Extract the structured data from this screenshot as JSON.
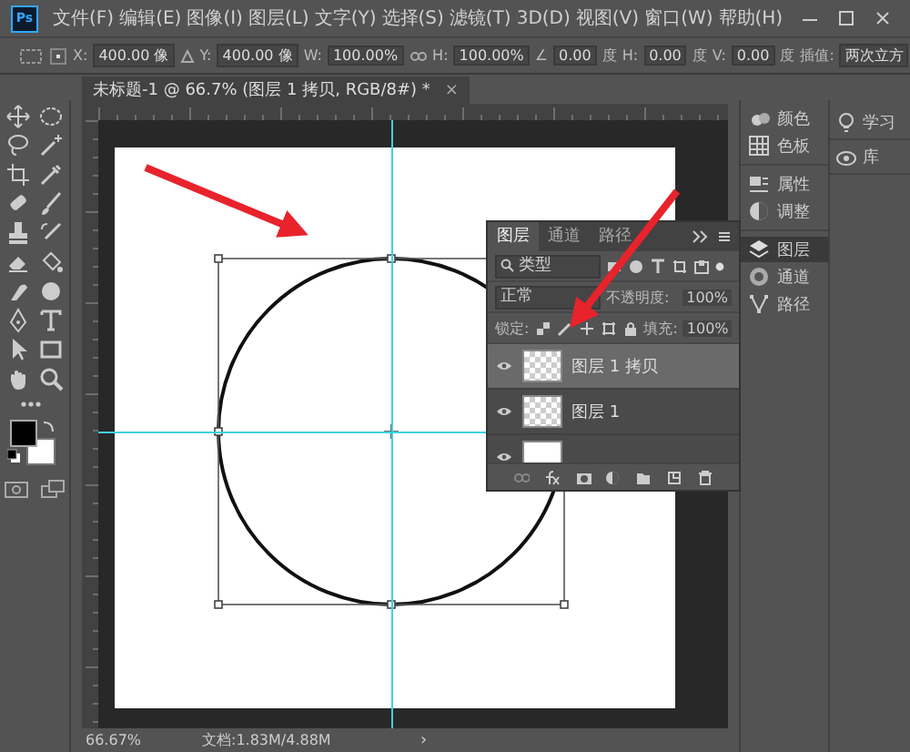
{
  "app": {
    "logo": "Ps"
  },
  "menu": [
    "文件(F)",
    "编辑(E)",
    "图像(I)",
    "图层(L)",
    "文字(Y)",
    "选择(S)",
    "滤镜(T)",
    "3D(D)",
    "视图(V)",
    "窗口(W)",
    "帮助(H)"
  ],
  "options": [
    {
      "label": "X:",
      "value": "400.00 像"
    },
    {
      "label": "Y:",
      "value": "400.00 像"
    },
    {
      "label": "W:",
      "value": "100.00%"
    },
    {
      "label": "H:",
      "value": "100.00%"
    },
    {
      "label": "∠",
      "value": "0.00",
      "unit": "度"
    },
    {
      "label": "H:",
      "value": "0.00",
      "unit": "度"
    },
    {
      "label": "V:",
      "value": "0.00",
      "unit": "度"
    },
    {
      "label": "插值:",
      "value": "两次立方"
    }
  ],
  "document_tab": {
    "title": "未标题-1 @ 66.7% (图层 1 拷贝, RGB/8#) *",
    "close": "×"
  },
  "layers_panel": {
    "tabs": [
      {
        "label": "图层",
        "selected": true
      },
      {
        "label": "通道",
        "selected": false
      },
      {
        "label": "路径",
        "selected": false
      }
    ],
    "filter": "类型",
    "blend_mode": "正常",
    "opacity_label": "不透明度:",
    "opacity": "100%",
    "lock_label": "锁定:",
    "fill_label": "填充:",
    "fill": "100%",
    "layers": [
      {
        "name": "图层 1 拷贝",
        "visible": true,
        "selected": true,
        "transparent": true
      },
      {
        "name": "图层 1",
        "visible": true,
        "selected": false,
        "transparent": true
      },
      {
        "visible": true,
        "selected": false,
        "transparent": false
      }
    ]
  },
  "dock": [
    {
      "label": "颜色",
      "selected": false
    },
    {
      "label": "色板",
      "selected": false
    },
    {
      "label": "属性",
      "selected": false
    },
    {
      "label": "调整",
      "selected": false
    },
    {
      "label": "图层",
      "selected": true
    },
    {
      "label": "通道",
      "selected": false
    },
    {
      "label": "路径",
      "selected": false
    }
  ],
  "dock2": [
    {
      "label": "学习"
    },
    {
      "label": "库"
    }
  ],
  "status_bar": {
    "zoom": "66.67%",
    "doc": "文档:1.83M/4.88M",
    "arrow": "›"
  }
}
